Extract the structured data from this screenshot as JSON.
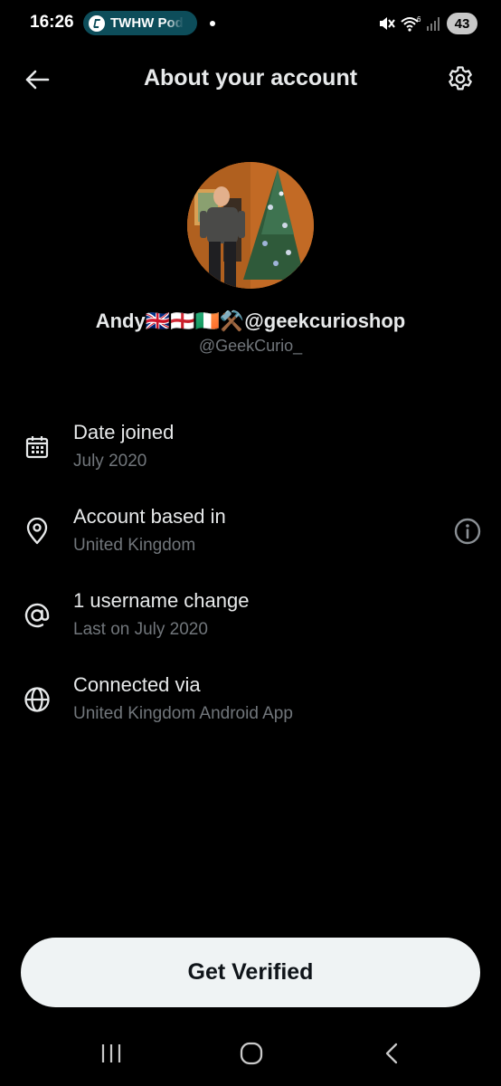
{
  "status_bar": {
    "time": "16:26",
    "notification_app": "TWHW Pod",
    "battery": "43",
    "icons": [
      "mute-icon",
      "wifi-icon",
      "signal-icon"
    ]
  },
  "header": {
    "title": "About your account",
    "back_icon": "arrow-left-icon",
    "settings_icon": "gear-icon"
  },
  "profile": {
    "display_name": "Andy🇬🇧🏴󠁧󠁢󠁥󠁮󠁧󠁿🇮🇪⚒️@geekcurioshop",
    "handle": "@GeekCurio_"
  },
  "details": [
    {
      "icon": "calendar-icon",
      "title": "Date joined",
      "subtitle": "July 2020"
    },
    {
      "icon": "location-pin-icon",
      "title": "Account based in",
      "subtitle": "United Kingdom",
      "action_icon": "info-icon"
    },
    {
      "icon": "at-sign-icon",
      "title": "1 username change",
      "subtitle": "Last on July 2020"
    },
    {
      "icon": "globe-icon",
      "title": "Connected via",
      "subtitle": "United Kingdom Android App"
    }
  ],
  "cta": {
    "label": "Get Verified"
  },
  "nav_bar": {
    "icons": [
      "recents-icon",
      "home-icon",
      "back-icon"
    ]
  },
  "colors": {
    "background": "#000000",
    "primary_text": "#e7e9ea",
    "secondary_text": "#71767b",
    "button_bg": "#eff3f4",
    "button_text": "#0f1419"
  }
}
